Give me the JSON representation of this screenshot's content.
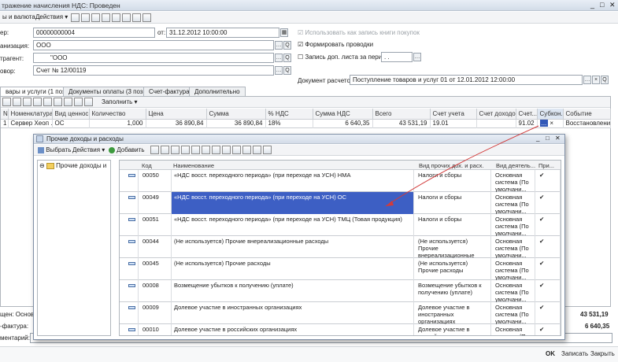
{
  "window": {
    "title": "тражение начисления НДС: Проведен"
  },
  "toolbar": {
    "menu1": "ы и валюта...",
    "menu2": "Действия"
  },
  "form": {
    "number_label": "ер:",
    "number_value": "00000000004",
    "date_label": "от:",
    "date_value": "31.12.2012 10:00:00",
    "org_label": "анизация:",
    "org_value": "ООО",
    "contractor_label": "трагент:",
    "contractor_value": "\"ООО",
    "contract_label": "овор:",
    "contract_value": "Счет № 12/00119",
    "check_purchase_book": "Использовать как запись книги покупок",
    "check_postings": "Формировать проводки",
    "check_extra_sheet": "Запись доп. листа за период:",
    "period_value": ". .",
    "settlement_label": "Документ расчетов:",
    "settlement_value": "Поступление товаров и услуг 01 от 12.01.2012 12:00:00"
  },
  "tabs": [
    {
      "label": "вары и услуги (1 поз.)"
    },
    {
      "label": "Документы оплаты (3 поз.)"
    },
    {
      "label": "Счет-фактура"
    },
    {
      "label": "Дополнительно"
    }
  ],
  "table_toolbar": {
    "fill": "Заполнить"
  },
  "table": {
    "headers": [
      "N",
      "Номенклатура",
      "Вид ценнос...",
      "Количество",
      "Цена",
      "Сумма",
      "% НДС",
      "Сумма НДС",
      "Всего",
      "Счет учета",
      "Счет доходов",
      "Счет...",
      "Субкон...",
      "Событие"
    ],
    "row": [
      "1",
      "Сервер Хеоп ...",
      "ОС",
      "1,000",
      "36 890,84",
      "36 890,84",
      "18%",
      "6 640,35",
      "43 531,19",
      "19.01",
      "",
      "91.02",
      "...",
      "Восстановление НДС"
    ]
  },
  "footer": {
    "label1": "щен: Основн",
    "label2": "-фактура:",
    "label3": "ментарий:",
    "total": "43 531,19",
    "vat": "6 640,35",
    "ok": "OK",
    "save": "Записать",
    "close": "Закрыть"
  },
  "dialog": {
    "title": "Прочие доходы и расходы",
    "select": "Выбрать",
    "actions": "Действия",
    "add": "Добавить",
    "tree_root": "Прочие доходы и р",
    "headers": {
      "code": "Код",
      "name": "Наименование",
      "kind": "Вид прочих дох. и расх.",
      "activity": "Вид деятель...",
      "flag": "При..."
    },
    "rows": [
      {
        "code": "00050",
        "name": "«НДС восст. переходного периода» (при переходе на УСН) НМА",
        "kind": "Налоги и сборы",
        "activity": "Основная система (По умолчани...",
        "flag": "✔"
      },
      {
        "code": "00049",
        "name": "«НДС восст. переходного периода» (при переходе на УСН) ОС",
        "kind": "Налоги и сборы",
        "activity": "Основная система (По умолчани...",
        "flag": "✔"
      },
      {
        "code": "00051",
        "name": "«НДС восст. переходного периода» (при переходе на УСН) ТМЦ (Товая продукция)",
        "kind": "Налоги и сборы",
        "activity": "Основная система (По умолчани...",
        "flag": "✔"
      },
      {
        "code": "00044",
        "name": "(Не используется) Прочие внереализационные расходы",
        "kind": "(Не используется) Прочие внереализационные расходы",
        "activity": "Основная система (По умолчани...",
        "flag": "✔"
      },
      {
        "code": "00045",
        "name": "(Не используется) Прочие расходы",
        "kind": "(Не используется) Прочие расходы",
        "activity": "Основная система (По умолчани...",
        "flag": "✔"
      },
      {
        "code": "00008",
        "name": "Возмещение убытков к получению (уплате)",
        "kind": "Возмещение убытков к получению (уплате)",
        "activity": "Основная система (По умолчани...",
        "flag": "✔"
      },
      {
        "code": "00009",
        "name": "Долевое участие в иностранных организациях",
        "kind": "Долевое участие в иностранных организациях",
        "activity": "Основная система (По умолчани...",
        "flag": "✔"
      },
      {
        "code": "00010",
        "name": "Долевое участие в российских организациях",
        "kind": "Долевое участие в российских организациях",
        "activity": "Основная система (По ...",
        "flag": "✔"
      }
    ]
  }
}
